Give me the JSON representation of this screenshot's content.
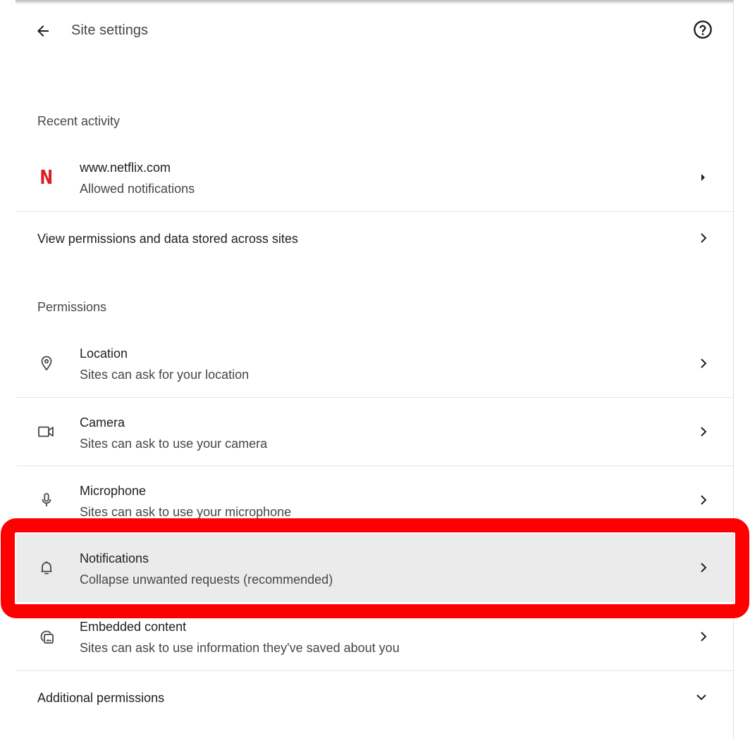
{
  "header": {
    "title": "Site settings",
    "back_icon": "arrow-back-icon",
    "help_icon": "help-circle-icon"
  },
  "recent_activity": {
    "heading": "Recent activity",
    "items": [
      {
        "site": "www.netflix.com",
        "detail": "Allowed notifications",
        "logo_text": "N",
        "logo_color": "#d81f26",
        "chevron_icon": "arrow-right-filled-icon"
      }
    ],
    "view_all_label": "View permissions and data stored across sites"
  },
  "permissions": {
    "heading": "Permissions",
    "items": [
      {
        "label": "Location",
        "description": "Sites can ask for your location",
        "icon": "location-pin-icon"
      },
      {
        "label": "Camera",
        "description": "Sites can ask to use your camera",
        "icon": "videocam-icon"
      },
      {
        "label": "Microphone",
        "description": "Sites can ask to use your microphone",
        "icon": "microphone-icon"
      },
      {
        "label": "Notifications",
        "description": "Collapse unwanted requests (recommended)",
        "icon": "bell-icon",
        "highlighted": true
      },
      {
        "label": "Embedded content",
        "description": "Sites can ask to use information they've saved about you",
        "icon": "embedded-content-icon"
      }
    ],
    "additional_label": "Additional permissions",
    "additional_icon": "chevron-down-icon"
  },
  "colors": {
    "highlight_border": "#ff0000",
    "highlight_row_bg": "#ebebeb",
    "text_primary": "#1f1f1f",
    "text_secondary": "#474747"
  }
}
